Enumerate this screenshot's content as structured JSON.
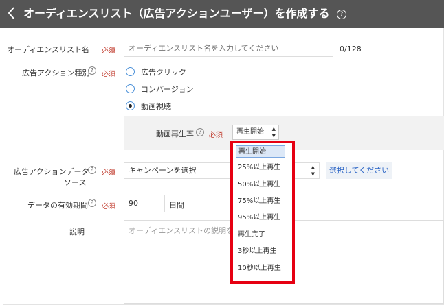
{
  "header": {
    "back_icon": "chevron-left-icon",
    "title": "オーディエンスリスト（広告アクションユーザー）を作成する",
    "help_icon": "question-circle-icon"
  },
  "form": {
    "required_label": "必須",
    "list_name": {
      "label": "オーディエンスリスト名",
      "placeholder": "オーディエンスリスト名を入力してください",
      "counter": "0/128"
    },
    "action_type": {
      "label": "広告アクション種別",
      "options": [
        "広告クリック",
        "コンバージョン",
        "動画視聴"
      ],
      "selected": "動画視聴"
    },
    "playback_rate": {
      "label": "動画再生率",
      "selected_value": "再生開始",
      "options": [
        "再生開始",
        "25%以上再生",
        "50%以上再生",
        "75%以上再生",
        "95%以上再生",
        "再生完了",
        "3秒以上再生",
        "10秒以上再生"
      ]
    },
    "data_source": {
      "label_line1": "広告アクションデータ",
      "label_line2": "ソース",
      "select_value": "キャンペーンを選択",
      "button_label": "選択してください"
    },
    "validity": {
      "label": "データの有効期間",
      "value": "90",
      "unit": "日間"
    },
    "description": {
      "label": "説明",
      "placeholder": "オーディエンスリストの説明を入"
    }
  },
  "colors": {
    "header_bg": "#555555",
    "required_red": "#c0392b",
    "highlight_border": "#e60012",
    "link_blue": "#2a64c5"
  }
}
